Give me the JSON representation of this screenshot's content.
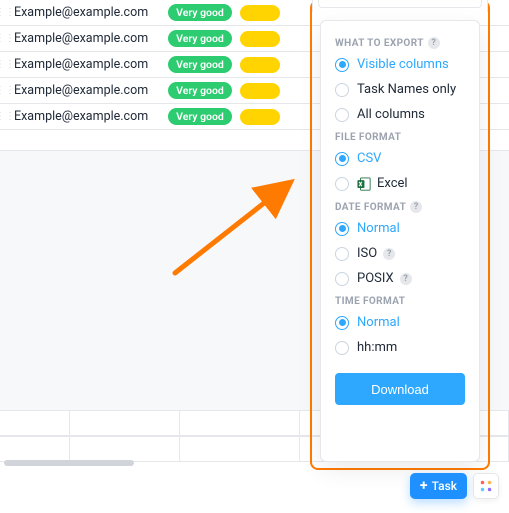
{
  "table": {
    "rows": [
      {
        "email": "Example@example.com",
        "status": "Very good"
      },
      {
        "email": "Example@example.com",
        "status": "Very good"
      },
      {
        "email": "Example@example.com",
        "status": "Very good"
      },
      {
        "email": "Example@example.com",
        "status": "Very good"
      },
      {
        "email": "Example@example.com",
        "status": "Very good"
      }
    ]
  },
  "export_panel": {
    "what_to_export": {
      "title": "WHAT TO EXPORT",
      "options": {
        "visible": "Visible columns",
        "names": "Task Names only",
        "all": "All columns"
      },
      "selected": "visible"
    },
    "file_format": {
      "title": "FILE FORMAT",
      "options": {
        "csv": "CSV",
        "excel": "Excel"
      },
      "selected": "csv"
    },
    "date_format": {
      "title": "DATE FORMAT",
      "options": {
        "normal": "Normal",
        "iso": "ISO",
        "posix": "POSIX"
      },
      "selected": "normal"
    },
    "time_format": {
      "title": "TIME FORMAT",
      "options": {
        "normal": "Normal",
        "hhmm": "hh:mm"
      },
      "selected": "normal"
    },
    "download_label": "Download"
  },
  "footer": {
    "new_task_label": "Task"
  }
}
